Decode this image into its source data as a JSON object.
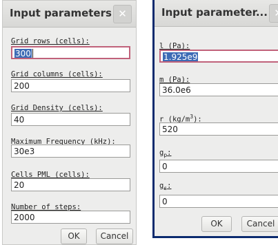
{
  "dialog1": {
    "title": "Input parameters ...",
    "close_icon": "close-icon",
    "fields": [
      {
        "label": "Grid rows (cells):",
        "value": "300"
      },
      {
        "label": "Grid columns (cells):",
        "value": "200"
      },
      {
        "label": "Grid Density (cells):",
        "value": "40"
      },
      {
        "label": "Maximum Frequency (kHz):",
        "value": "30e3"
      },
      {
        "label": "Cells PML (cells):",
        "value": "20"
      },
      {
        "label": "Number of steps:",
        "value": "2000"
      }
    ],
    "ok_label": "OK",
    "cancel_label": "Cancel"
  },
  "dialog2": {
    "title": "Input parameter...",
    "close_icon": "close-icon",
    "fields": [
      {
        "label": "l (Pa):",
        "value": "1.925e9"
      },
      {
        "label": "m (Pa):",
        "value": "36.0e6"
      },
      {
        "label_main": "r (kg/m",
        "label_sup": "3",
        "label_end": "):",
        "value": "520"
      },
      {
        "label_main": "g",
        "label_sub": "p",
        "label_end": ":",
        "value": "0"
      },
      {
        "label_main": "g",
        "label_sub": "s",
        "label_end": ":",
        "value": "0"
      }
    ],
    "ok_label": "OK",
    "cancel_label": "Cancel"
  }
}
